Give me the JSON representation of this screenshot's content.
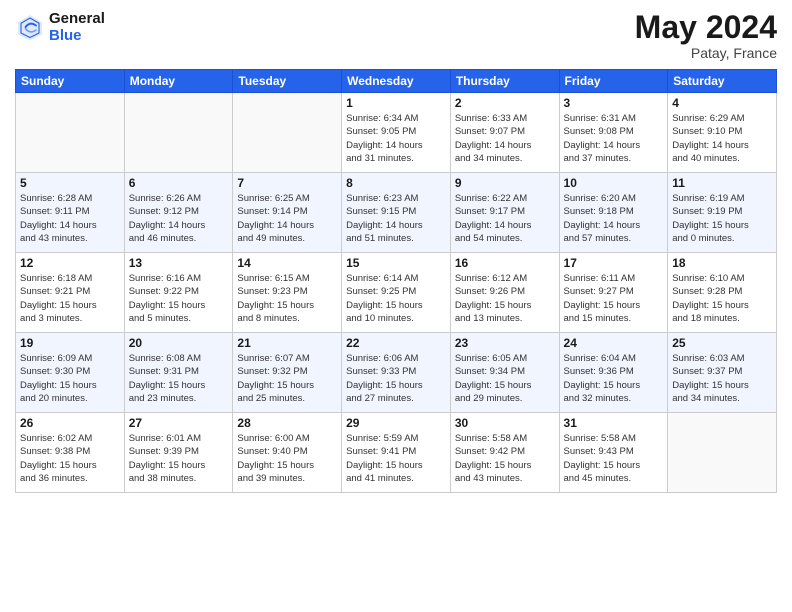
{
  "header": {
    "logo_line1": "General",
    "logo_line2": "Blue",
    "month": "May 2024",
    "location": "Patay, France"
  },
  "weekdays": [
    "Sunday",
    "Monday",
    "Tuesday",
    "Wednesday",
    "Thursday",
    "Friday",
    "Saturday"
  ],
  "weeks": [
    [
      {
        "day": "",
        "text": ""
      },
      {
        "day": "",
        "text": ""
      },
      {
        "day": "",
        "text": ""
      },
      {
        "day": "1",
        "text": "Sunrise: 6:34 AM\nSunset: 9:05 PM\nDaylight: 14 hours\nand 31 minutes."
      },
      {
        "day": "2",
        "text": "Sunrise: 6:33 AM\nSunset: 9:07 PM\nDaylight: 14 hours\nand 34 minutes."
      },
      {
        "day": "3",
        "text": "Sunrise: 6:31 AM\nSunset: 9:08 PM\nDaylight: 14 hours\nand 37 minutes."
      },
      {
        "day": "4",
        "text": "Sunrise: 6:29 AM\nSunset: 9:10 PM\nDaylight: 14 hours\nand 40 minutes."
      }
    ],
    [
      {
        "day": "5",
        "text": "Sunrise: 6:28 AM\nSunset: 9:11 PM\nDaylight: 14 hours\nand 43 minutes."
      },
      {
        "day": "6",
        "text": "Sunrise: 6:26 AM\nSunset: 9:12 PM\nDaylight: 14 hours\nand 46 minutes."
      },
      {
        "day": "7",
        "text": "Sunrise: 6:25 AM\nSunset: 9:14 PM\nDaylight: 14 hours\nand 49 minutes."
      },
      {
        "day": "8",
        "text": "Sunrise: 6:23 AM\nSunset: 9:15 PM\nDaylight: 14 hours\nand 51 minutes."
      },
      {
        "day": "9",
        "text": "Sunrise: 6:22 AM\nSunset: 9:17 PM\nDaylight: 14 hours\nand 54 minutes."
      },
      {
        "day": "10",
        "text": "Sunrise: 6:20 AM\nSunset: 9:18 PM\nDaylight: 14 hours\nand 57 minutes."
      },
      {
        "day": "11",
        "text": "Sunrise: 6:19 AM\nSunset: 9:19 PM\nDaylight: 15 hours\nand 0 minutes."
      }
    ],
    [
      {
        "day": "12",
        "text": "Sunrise: 6:18 AM\nSunset: 9:21 PM\nDaylight: 15 hours\nand 3 minutes."
      },
      {
        "day": "13",
        "text": "Sunrise: 6:16 AM\nSunset: 9:22 PM\nDaylight: 15 hours\nand 5 minutes."
      },
      {
        "day": "14",
        "text": "Sunrise: 6:15 AM\nSunset: 9:23 PM\nDaylight: 15 hours\nand 8 minutes."
      },
      {
        "day": "15",
        "text": "Sunrise: 6:14 AM\nSunset: 9:25 PM\nDaylight: 15 hours\nand 10 minutes."
      },
      {
        "day": "16",
        "text": "Sunrise: 6:12 AM\nSunset: 9:26 PM\nDaylight: 15 hours\nand 13 minutes."
      },
      {
        "day": "17",
        "text": "Sunrise: 6:11 AM\nSunset: 9:27 PM\nDaylight: 15 hours\nand 15 minutes."
      },
      {
        "day": "18",
        "text": "Sunrise: 6:10 AM\nSunset: 9:28 PM\nDaylight: 15 hours\nand 18 minutes."
      }
    ],
    [
      {
        "day": "19",
        "text": "Sunrise: 6:09 AM\nSunset: 9:30 PM\nDaylight: 15 hours\nand 20 minutes."
      },
      {
        "day": "20",
        "text": "Sunrise: 6:08 AM\nSunset: 9:31 PM\nDaylight: 15 hours\nand 23 minutes."
      },
      {
        "day": "21",
        "text": "Sunrise: 6:07 AM\nSunset: 9:32 PM\nDaylight: 15 hours\nand 25 minutes."
      },
      {
        "day": "22",
        "text": "Sunrise: 6:06 AM\nSunset: 9:33 PM\nDaylight: 15 hours\nand 27 minutes."
      },
      {
        "day": "23",
        "text": "Sunrise: 6:05 AM\nSunset: 9:34 PM\nDaylight: 15 hours\nand 29 minutes."
      },
      {
        "day": "24",
        "text": "Sunrise: 6:04 AM\nSunset: 9:36 PM\nDaylight: 15 hours\nand 32 minutes."
      },
      {
        "day": "25",
        "text": "Sunrise: 6:03 AM\nSunset: 9:37 PM\nDaylight: 15 hours\nand 34 minutes."
      }
    ],
    [
      {
        "day": "26",
        "text": "Sunrise: 6:02 AM\nSunset: 9:38 PM\nDaylight: 15 hours\nand 36 minutes."
      },
      {
        "day": "27",
        "text": "Sunrise: 6:01 AM\nSunset: 9:39 PM\nDaylight: 15 hours\nand 38 minutes."
      },
      {
        "day": "28",
        "text": "Sunrise: 6:00 AM\nSunset: 9:40 PM\nDaylight: 15 hours\nand 39 minutes."
      },
      {
        "day": "29",
        "text": "Sunrise: 5:59 AM\nSunset: 9:41 PM\nDaylight: 15 hours\nand 41 minutes."
      },
      {
        "day": "30",
        "text": "Sunrise: 5:58 AM\nSunset: 9:42 PM\nDaylight: 15 hours\nand 43 minutes."
      },
      {
        "day": "31",
        "text": "Sunrise: 5:58 AM\nSunset: 9:43 PM\nDaylight: 15 hours\nand 45 minutes."
      },
      {
        "day": "",
        "text": ""
      }
    ]
  ]
}
